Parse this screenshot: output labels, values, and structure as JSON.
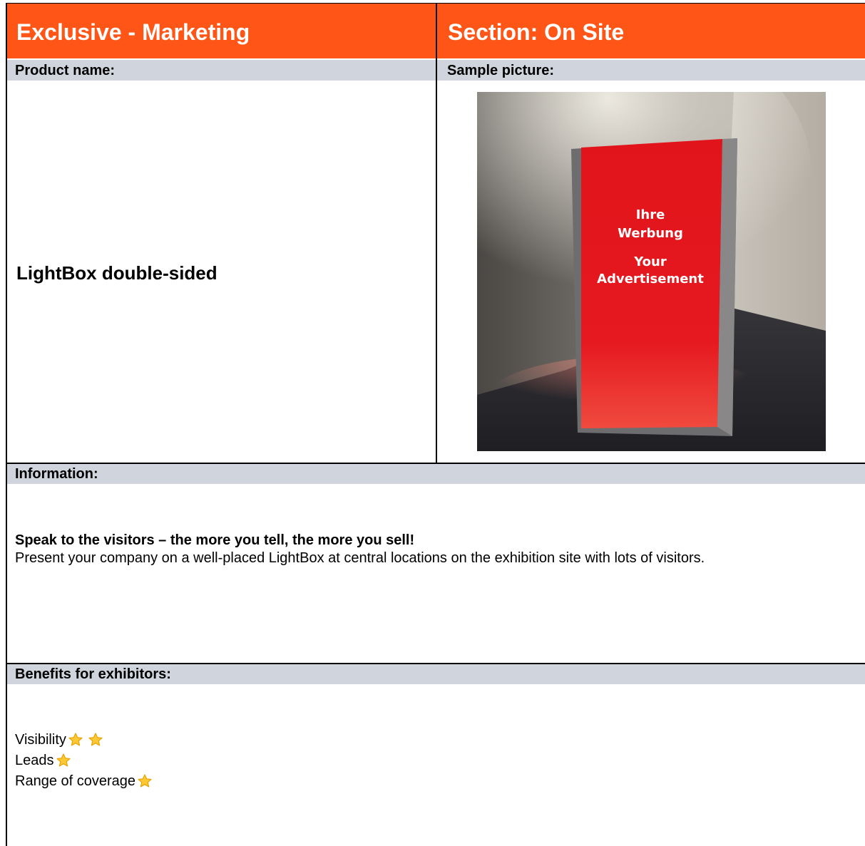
{
  "header": {
    "left_title": "Exclusive - Marketing",
    "right_title": "Section: On Site",
    "accent_color": "#ff5516"
  },
  "product": {
    "label": "Product name:",
    "name": "LightBox double-sided"
  },
  "sample": {
    "label": "Sample picture:",
    "sign_text_de_1": "Ihre",
    "sign_text_de_2": "Werbung",
    "sign_text_en_1": "Your",
    "sign_text_en_2": "Advertisement",
    "sign_color": "#e0161c"
  },
  "information": {
    "label": "Information:",
    "heading": "Speak to the visitors – the more you tell, the more you sell!",
    "text": "Present your company on a well-placed LightBox at central locations on the exhibition site with lots of visitors."
  },
  "benefits": {
    "label": "Benefits for exhibitors:",
    "items": [
      {
        "label": "Visibility",
        "stars": 2
      },
      {
        "label": "Leads ",
        "stars": 1
      },
      {
        "label": "Range of coverage",
        "stars": 1
      }
    ],
    "star_icon": "star-icon",
    "star_color": "#fcc934"
  }
}
